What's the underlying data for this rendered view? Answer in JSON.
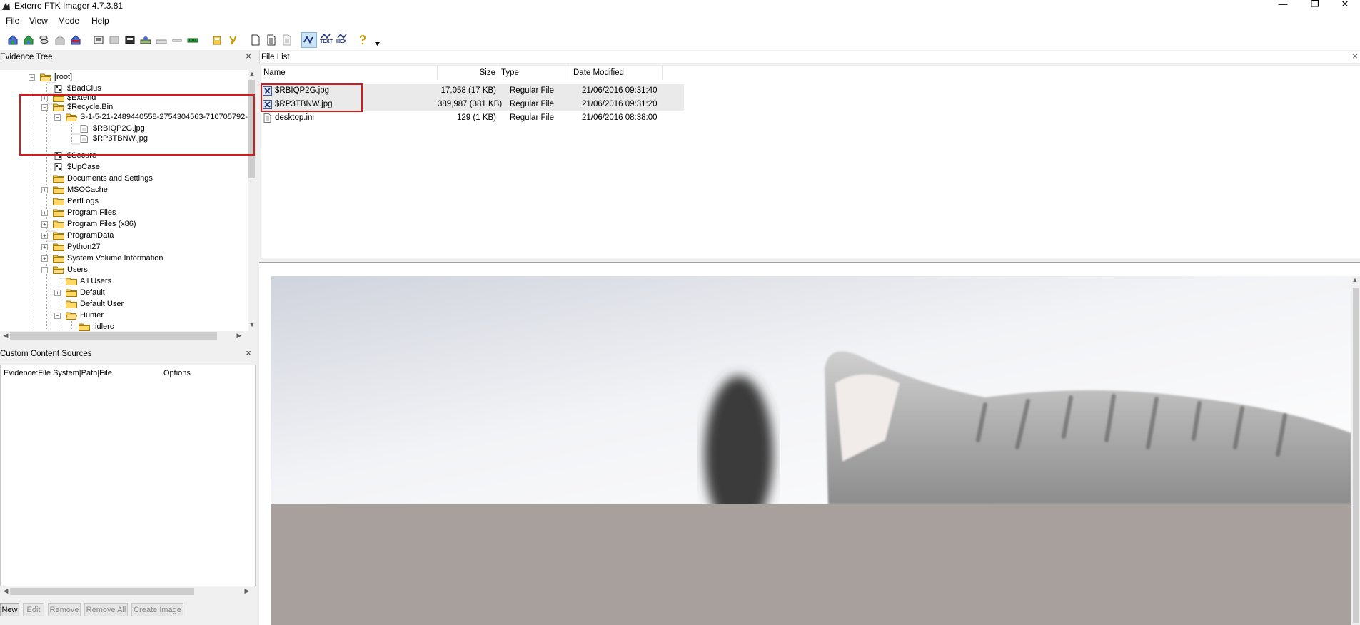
{
  "window": {
    "title": "Exterro FTK Imager 4.7.3.81",
    "controls": {
      "minimize": "—",
      "restore": "❐",
      "close": "✕"
    }
  },
  "menu": [
    {
      "label": "File",
      "underline": "F"
    },
    {
      "label": "View",
      "underline": "V"
    },
    {
      "label": "Mode",
      "underline": "M"
    },
    {
      "label": "Help",
      "underline": "H"
    }
  ],
  "toolbar": {
    "icons": [
      "add-evidence-icon",
      "add-all-evidence-icon",
      "image-mounting-icon",
      "remove-evidence-icon",
      "remove-all-evidence-icon",
      "create-disk-image-icon",
      "export-disk-image-icon",
      "export-logical-image-icon",
      "capture-memory-icon",
      "obtain-protected-files-icon",
      "detect-efs-icon",
      "verify-drive-icon",
      "export-files-icon",
      "export-hash-list-icon",
      "new-document-icon",
      "list-view-icon",
      "properties-icon",
      "auto-view-icon",
      "text-view-icon",
      "hex-view-icon",
      "help-icon",
      "dropdown-icon"
    ],
    "text_label": "TEXT",
    "hex_label": "HEX"
  },
  "evidence_tree": {
    "header": "Evidence Tree",
    "close": "×",
    "items": [
      {
        "label": "[root]",
        "icon": "folder-open-icon",
        "expander": "−"
      },
      {
        "label": "$BadClus",
        "icon": "system-file-icon"
      },
      {
        "label": "$Extend",
        "icon": "folder-icon",
        "expander": "+"
      },
      {
        "label": "$Recycle.Bin",
        "icon": "folder-open-icon",
        "expander": "−"
      },
      {
        "label": "S-1-5-21-2489440558-2754304563-710705792-",
        "icon": "folder-open-icon",
        "expander": "−"
      },
      {
        "label": "$RBIQP2G.jpg",
        "icon": "file-icon"
      },
      {
        "label": "$RP3TBNW.jpg",
        "icon": "file-icon"
      },
      {
        "label": "$Secure",
        "icon": "system-file-icon"
      },
      {
        "label": "$UpCase",
        "icon": "system-file-icon"
      },
      {
        "label": "Documents and Settings",
        "icon": "folder-icon"
      },
      {
        "label": "MSOCache",
        "icon": "folder-icon",
        "expander": "+"
      },
      {
        "label": "PerfLogs",
        "icon": "folder-icon"
      },
      {
        "label": "Program Files",
        "icon": "folder-icon",
        "expander": "+"
      },
      {
        "label": "Program Files (x86)",
        "icon": "folder-icon",
        "expander": "+"
      },
      {
        "label": "ProgramData",
        "icon": "folder-icon",
        "expander": "+"
      },
      {
        "label": "Python27",
        "icon": "folder-icon",
        "expander": "+"
      },
      {
        "label": "System Volume Information",
        "icon": "folder-icon",
        "expander": "+"
      },
      {
        "label": "Users",
        "icon": "folder-open-icon",
        "expander": "−"
      },
      {
        "label": "All Users",
        "icon": "folder-icon"
      },
      {
        "label": "Default",
        "icon": "folder-icon",
        "expander": "+"
      },
      {
        "label": "Default User",
        "icon": "folder-icon"
      },
      {
        "label": "Hunter",
        "icon": "folder-open-icon",
        "expander": "−"
      },
      {
        "label": ".idlerc",
        "icon": "folder-icon"
      }
    ]
  },
  "file_list": {
    "header": "File List",
    "close": "×",
    "columns": [
      "Name",
      "Size",
      "Type",
      "Date Modified"
    ],
    "rows": [
      {
        "name": "$RBIQP2G.jpg",
        "size": "17,058 (17 KB)",
        "type": "Regular File",
        "date": "21/06/2016 09:31:40",
        "icon": "deleted-file-icon",
        "selected": true
      },
      {
        "name": "$RP3TBNW.jpg",
        "size": "389,987 (381 KB)",
        "type": "Regular File",
        "date": "21/06/2016 09:31:20",
        "icon": "deleted-file-icon",
        "selected": true
      },
      {
        "name": "desktop.ini",
        "size": "129 (1 KB)",
        "type": "Regular File",
        "date": "21/06/2016 08:38:00",
        "icon": "file-icon",
        "selected": false
      }
    ]
  },
  "viewer": {
    "content": "kitten-photo-icon"
  },
  "custom_content_sources": {
    "header": "Custom Content Sources",
    "close": "×",
    "columns": [
      "Evidence:File System|Path|File",
      "Options"
    ],
    "buttons": [
      {
        "label": "New",
        "enabled": true
      },
      {
        "label": "Edit",
        "enabled": false
      },
      {
        "label": "Remove",
        "enabled": false
      },
      {
        "label": "Remove All",
        "enabled": false
      },
      {
        "label": "Create Image",
        "enabled": false
      }
    ]
  },
  "scroll": {
    "up": "▲",
    "down": "▼",
    "left": "◀",
    "right": "▶"
  },
  "colors": {
    "highlight_box": "#d21b1b",
    "folder": "#f2c94c",
    "selected_row": "#eaeaea",
    "viewer_placeholder": "#a8a09c"
  }
}
